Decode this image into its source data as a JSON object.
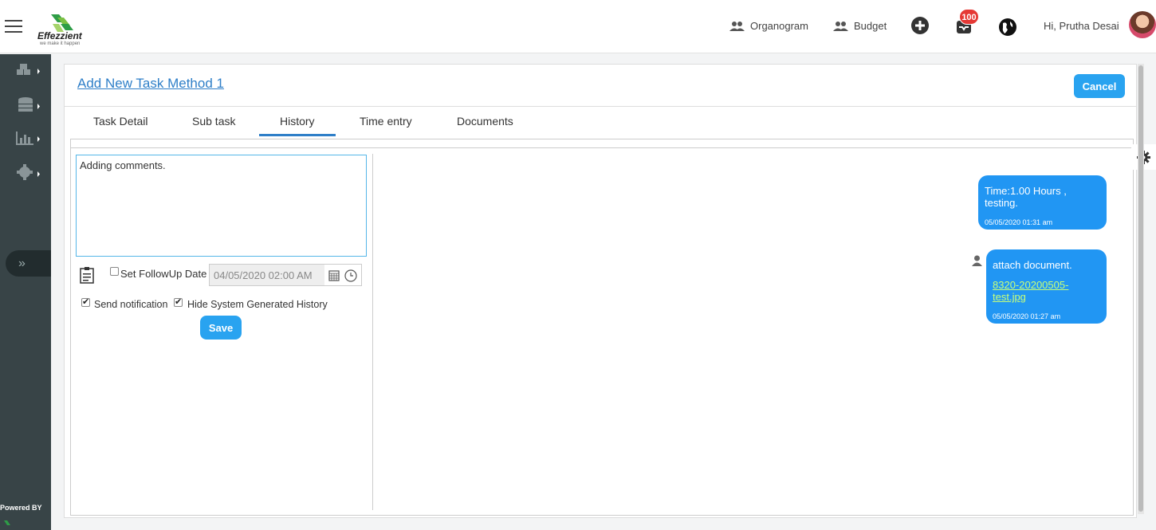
{
  "header": {
    "logo_name": "Effezzient",
    "logo_tagline": "we make it happen",
    "nav": {
      "organogram": "Organogram",
      "budget": "Budget"
    },
    "notification_count": "100",
    "greeting": "Hi, Prutha Desai"
  },
  "sidebar": {
    "items": [
      {
        "icon": "cubes-icon"
      },
      {
        "icon": "database-icon"
      },
      {
        "icon": "bar-chart-icon"
      },
      {
        "icon": "gear-icon"
      }
    ],
    "toggle_label": "»",
    "powered_by": "Powered BY"
  },
  "page": {
    "title": "Add New Task Method 1",
    "cancel_label": "Cancel",
    "tabs": [
      {
        "label": "Task Detail"
      },
      {
        "label": "Sub task"
      },
      {
        "label": "History",
        "active": true
      },
      {
        "label": "Time entry"
      },
      {
        "label": "Documents"
      }
    ]
  },
  "form": {
    "comment_value": "Adding comments.",
    "followup_label": "Set FollowUp Date",
    "followup_checked": false,
    "followup_date": "04/05/2020 02:00 AM",
    "send_notification_label": "Send notification",
    "send_notification_checked": true,
    "hide_history_label": "Hide System Generated History",
    "hide_history_checked": true,
    "save_label": "Save"
  },
  "history": [
    {
      "message": "Time:1.00 Hours , testing.",
      "timestamp": "05/05/2020 01:31 am"
    },
    {
      "message": "attach document.",
      "link": "8320-20200505-test.jpg",
      "timestamp": "05/05/2020 01:27 am"
    }
  ],
  "colors": {
    "accent": "#29a3f0",
    "bubble": "#2196f3",
    "sidebar": "#384447",
    "link": "#2f7fc8",
    "badge": "#e53935"
  }
}
